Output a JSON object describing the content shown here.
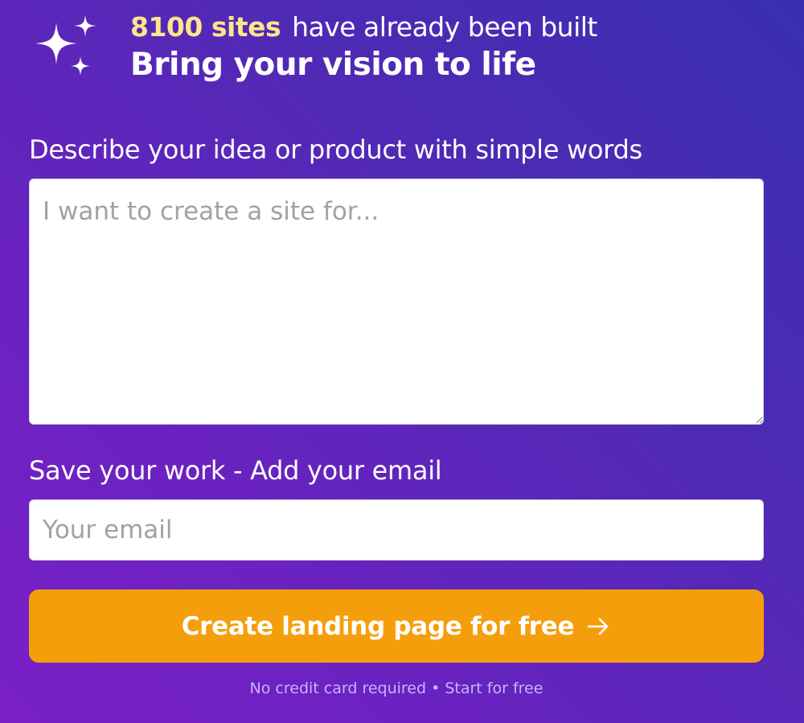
{
  "header": {
    "sparkles_icon": "sparkles-icon",
    "site_count": "8100 sites",
    "tagline": "have already been built",
    "headline": "Bring your vision to life"
  },
  "idea_field": {
    "label": "Describe your idea or product with simple words",
    "placeholder": "I want to create a site for...",
    "value": ""
  },
  "email_field": {
    "label": "Save your work - Add your email",
    "placeholder": "Your email",
    "value": ""
  },
  "cta": {
    "label": "Create landing page for free",
    "icon": "arrow-right-icon",
    "color": "#f59e0b"
  },
  "footnote": "No credit card required • Start for free",
  "colors": {
    "highlight": "#fde68a",
    "background_start": "#7a20c8",
    "background_end": "#3a2fb0"
  }
}
